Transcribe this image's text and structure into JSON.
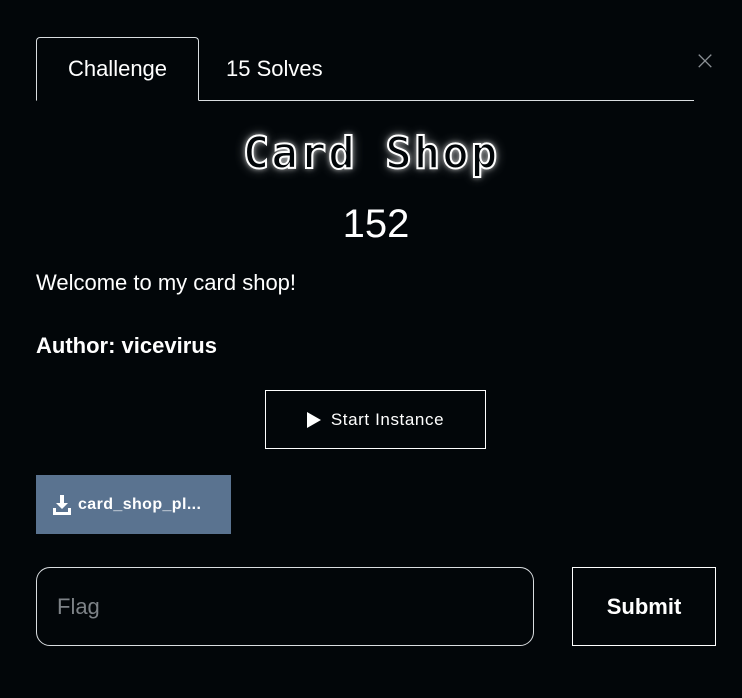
{
  "tabs": {
    "challenge": "Challenge",
    "solves": "15 Solves"
  },
  "close_icon": "×",
  "challenge": {
    "title": "Card Shop",
    "value": "152",
    "description": "Welcome to my card shop!",
    "author": "Author: vicevirus"
  },
  "actions": {
    "start_instance": "Start Instance",
    "file_name": "card_shop_pl..."
  },
  "flag": {
    "placeholder": "Flag",
    "value": ""
  },
  "submit_label": "Submit",
  "colors": {
    "background": "#020609",
    "file_button": "#5a7390",
    "border": "#d9dde0"
  },
  "icons": {
    "close": "close-icon",
    "play": "play-icon",
    "download": "download-icon"
  }
}
